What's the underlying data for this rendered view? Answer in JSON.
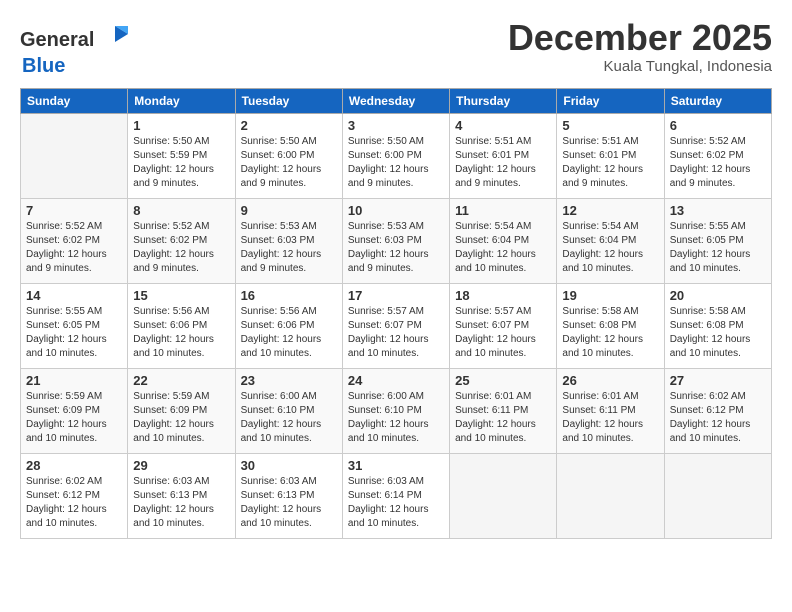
{
  "header": {
    "logo_general": "General",
    "logo_blue": "Blue",
    "month_title": "December 2025",
    "location": "Kuala Tungkal, Indonesia"
  },
  "days_of_week": [
    "Sunday",
    "Monday",
    "Tuesday",
    "Wednesday",
    "Thursday",
    "Friday",
    "Saturday"
  ],
  "weeks": [
    [
      {
        "day": "",
        "info": ""
      },
      {
        "day": "1",
        "info": "Sunrise: 5:50 AM\nSunset: 5:59 PM\nDaylight: 12 hours\nand 9 minutes."
      },
      {
        "day": "2",
        "info": "Sunrise: 5:50 AM\nSunset: 6:00 PM\nDaylight: 12 hours\nand 9 minutes."
      },
      {
        "day": "3",
        "info": "Sunrise: 5:50 AM\nSunset: 6:00 PM\nDaylight: 12 hours\nand 9 minutes."
      },
      {
        "day": "4",
        "info": "Sunrise: 5:51 AM\nSunset: 6:01 PM\nDaylight: 12 hours\nand 9 minutes."
      },
      {
        "day": "5",
        "info": "Sunrise: 5:51 AM\nSunset: 6:01 PM\nDaylight: 12 hours\nand 9 minutes."
      },
      {
        "day": "6",
        "info": "Sunrise: 5:52 AM\nSunset: 6:02 PM\nDaylight: 12 hours\nand 9 minutes."
      }
    ],
    [
      {
        "day": "7",
        "info": "Sunrise: 5:52 AM\nSunset: 6:02 PM\nDaylight: 12 hours\nand 9 minutes."
      },
      {
        "day": "8",
        "info": "Sunrise: 5:52 AM\nSunset: 6:02 PM\nDaylight: 12 hours\nand 9 minutes."
      },
      {
        "day": "9",
        "info": "Sunrise: 5:53 AM\nSunset: 6:03 PM\nDaylight: 12 hours\nand 9 minutes."
      },
      {
        "day": "10",
        "info": "Sunrise: 5:53 AM\nSunset: 6:03 PM\nDaylight: 12 hours\nand 9 minutes."
      },
      {
        "day": "11",
        "info": "Sunrise: 5:54 AM\nSunset: 6:04 PM\nDaylight: 12 hours\nand 10 minutes."
      },
      {
        "day": "12",
        "info": "Sunrise: 5:54 AM\nSunset: 6:04 PM\nDaylight: 12 hours\nand 10 minutes."
      },
      {
        "day": "13",
        "info": "Sunrise: 5:55 AM\nSunset: 6:05 PM\nDaylight: 12 hours\nand 10 minutes."
      }
    ],
    [
      {
        "day": "14",
        "info": "Sunrise: 5:55 AM\nSunset: 6:05 PM\nDaylight: 12 hours\nand 10 minutes."
      },
      {
        "day": "15",
        "info": "Sunrise: 5:56 AM\nSunset: 6:06 PM\nDaylight: 12 hours\nand 10 minutes."
      },
      {
        "day": "16",
        "info": "Sunrise: 5:56 AM\nSunset: 6:06 PM\nDaylight: 12 hours\nand 10 minutes."
      },
      {
        "day": "17",
        "info": "Sunrise: 5:57 AM\nSunset: 6:07 PM\nDaylight: 12 hours\nand 10 minutes."
      },
      {
        "day": "18",
        "info": "Sunrise: 5:57 AM\nSunset: 6:07 PM\nDaylight: 12 hours\nand 10 minutes."
      },
      {
        "day": "19",
        "info": "Sunrise: 5:58 AM\nSunset: 6:08 PM\nDaylight: 12 hours\nand 10 minutes."
      },
      {
        "day": "20",
        "info": "Sunrise: 5:58 AM\nSunset: 6:08 PM\nDaylight: 12 hours\nand 10 minutes."
      }
    ],
    [
      {
        "day": "21",
        "info": "Sunrise: 5:59 AM\nSunset: 6:09 PM\nDaylight: 12 hours\nand 10 minutes."
      },
      {
        "day": "22",
        "info": "Sunrise: 5:59 AM\nSunset: 6:09 PM\nDaylight: 12 hours\nand 10 minutes."
      },
      {
        "day": "23",
        "info": "Sunrise: 6:00 AM\nSunset: 6:10 PM\nDaylight: 12 hours\nand 10 minutes."
      },
      {
        "day": "24",
        "info": "Sunrise: 6:00 AM\nSunset: 6:10 PM\nDaylight: 12 hours\nand 10 minutes."
      },
      {
        "day": "25",
        "info": "Sunrise: 6:01 AM\nSunset: 6:11 PM\nDaylight: 12 hours\nand 10 minutes."
      },
      {
        "day": "26",
        "info": "Sunrise: 6:01 AM\nSunset: 6:11 PM\nDaylight: 12 hours\nand 10 minutes."
      },
      {
        "day": "27",
        "info": "Sunrise: 6:02 AM\nSunset: 6:12 PM\nDaylight: 12 hours\nand 10 minutes."
      }
    ],
    [
      {
        "day": "28",
        "info": "Sunrise: 6:02 AM\nSunset: 6:12 PM\nDaylight: 12 hours\nand 10 minutes."
      },
      {
        "day": "29",
        "info": "Sunrise: 6:03 AM\nSunset: 6:13 PM\nDaylight: 12 hours\nand 10 minutes."
      },
      {
        "day": "30",
        "info": "Sunrise: 6:03 AM\nSunset: 6:13 PM\nDaylight: 12 hours\nand 10 minutes."
      },
      {
        "day": "31",
        "info": "Sunrise: 6:03 AM\nSunset: 6:14 PM\nDaylight: 12 hours\nand 10 minutes."
      },
      {
        "day": "",
        "info": ""
      },
      {
        "day": "",
        "info": ""
      },
      {
        "day": "",
        "info": ""
      }
    ]
  ]
}
